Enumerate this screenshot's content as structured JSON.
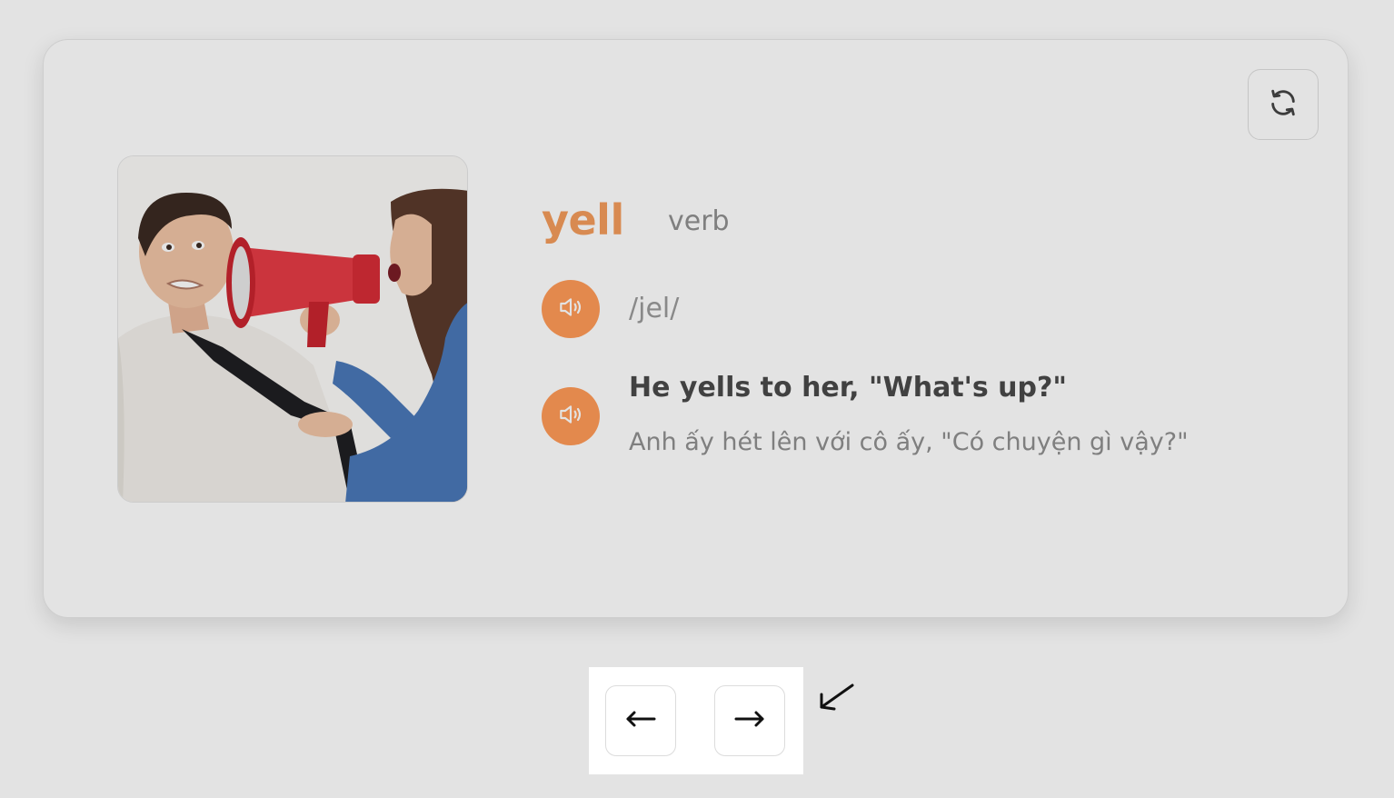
{
  "card": {
    "word": "yell",
    "part_of_speech": "verb",
    "ipa": "/jel/",
    "example": "He yells to her, \"What's up?\"",
    "translation": "Anh ấy hét lên với cô ấy, \"Có chuyện gì vậy?\"",
    "image_subject": "woman-yelling-through-megaphone"
  },
  "icons": {
    "flip": "refresh-icon",
    "audio": "speaker-icon",
    "prev": "arrow-left-icon",
    "next": "arrow-right-icon",
    "pointer": "arrow-pointer-icon"
  },
  "colors": {
    "accent": "#ff9a57",
    "word": "#f39c5b",
    "text_dark": "#4a4a4a",
    "text_muted": "#8f8f8f"
  }
}
